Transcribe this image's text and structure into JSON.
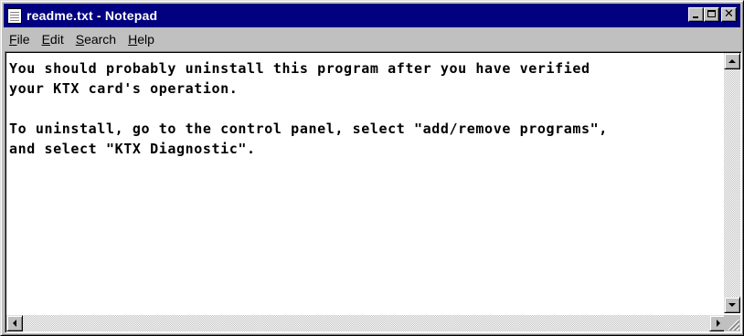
{
  "window": {
    "title": "readme.txt - Notepad",
    "colors": {
      "titlebar_active": "#000080",
      "face": "#c0c0c0",
      "edit_background": "#ffffff",
      "text": "#000000"
    }
  },
  "caption_buttons": {
    "minimize_icon": "minimize-icon",
    "maximize_icon": "maximize-icon",
    "close_glyph": "✕"
  },
  "menu": {
    "items": [
      {
        "label": "File",
        "accel": "F",
        "rest": "ile"
      },
      {
        "label": "Edit",
        "accel": "E",
        "rest": "dit"
      },
      {
        "label": "Search",
        "accel": "S",
        "rest": "earch"
      },
      {
        "label": "Help",
        "accel": "H",
        "rest": "elp"
      }
    ]
  },
  "document": {
    "content": "You should probably uninstall this program after you have verified\nyour KTX card's operation.\n\nTo uninstall, go to the control panel, select \"add/remove programs\",\nand select \"KTX Diagnostic\"."
  }
}
